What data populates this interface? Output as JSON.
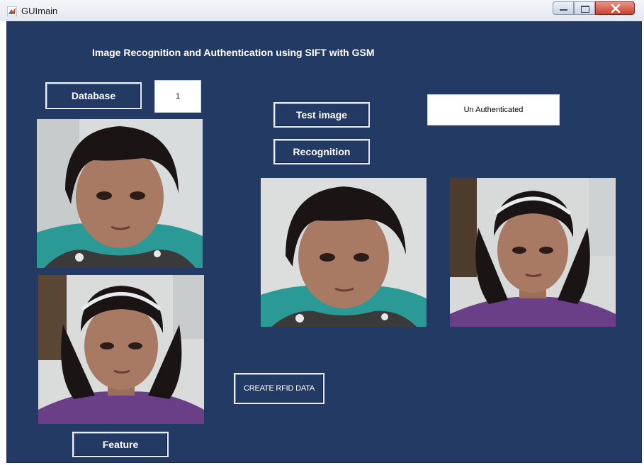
{
  "window": {
    "title": "GUImain"
  },
  "app": {
    "heading": "Image Recognition and Authentication using SIFT with GSM",
    "database_button": "Database",
    "database_index": "1",
    "test_image_button": "Test image",
    "recognition_button": "Recognition",
    "status_text": "Un Authenticated",
    "create_rfid_button": "CREATE RFID DATA",
    "feature_button": "Feature"
  },
  "colors": {
    "figure_background": "#233a65",
    "button_border": "#e9edf4",
    "close_button": "#c7412f"
  },
  "icons": {
    "app": "matlab-icon",
    "minimize": "minimize-icon",
    "maximize": "maximize-icon",
    "close": "close-icon"
  }
}
